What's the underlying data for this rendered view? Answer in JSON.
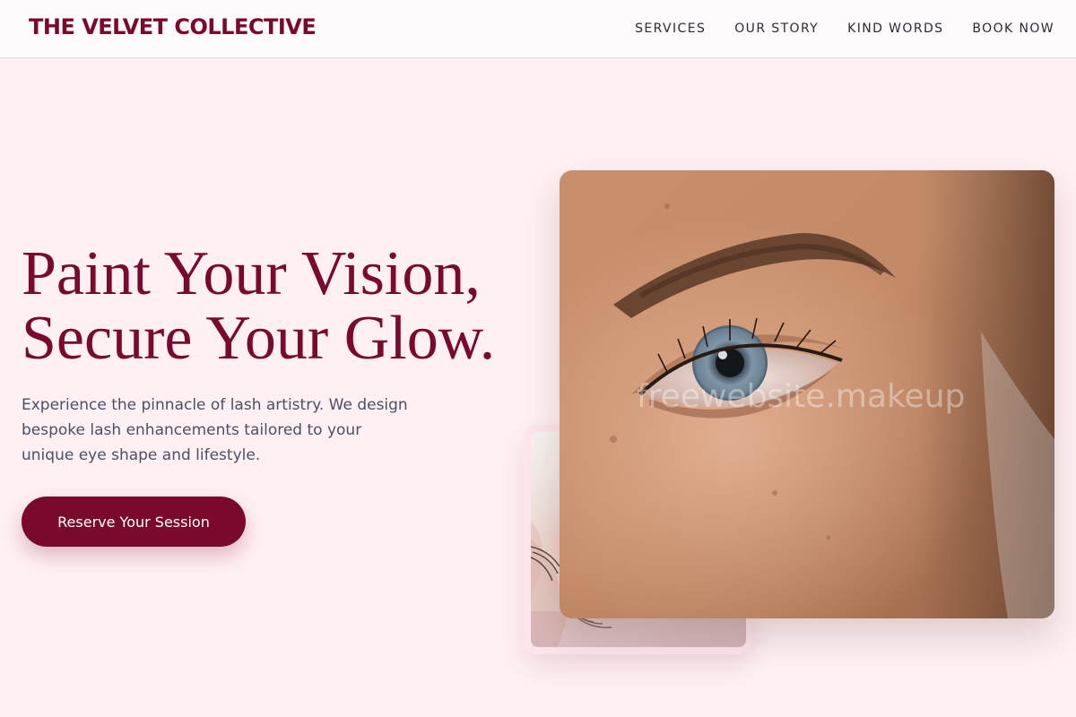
{
  "brand": {
    "name": "THE VELVET COLLECTIVE"
  },
  "nav": {
    "items": [
      {
        "label": "SERVICES"
      },
      {
        "label": "OUR STORY"
      },
      {
        "label": "KIND WORDS"
      },
      {
        "label": "BOOK NOW"
      }
    ]
  },
  "hero": {
    "headline_line1": "Paint Your Vision,",
    "headline_line2": "Secure Your Glow.",
    "lead": "Experience the pinnacle of lash artistry. We design bespoke lash enhancements tailored to your unique eye shape and lifestyle.",
    "cta_label": "Reserve Your Session"
  },
  "images": {
    "main_watermark": "freewebsite.makeup"
  },
  "colors": {
    "accent": "#7a0a2c",
    "page_background": "#fff0f4",
    "body_text": "#4a5066"
  }
}
